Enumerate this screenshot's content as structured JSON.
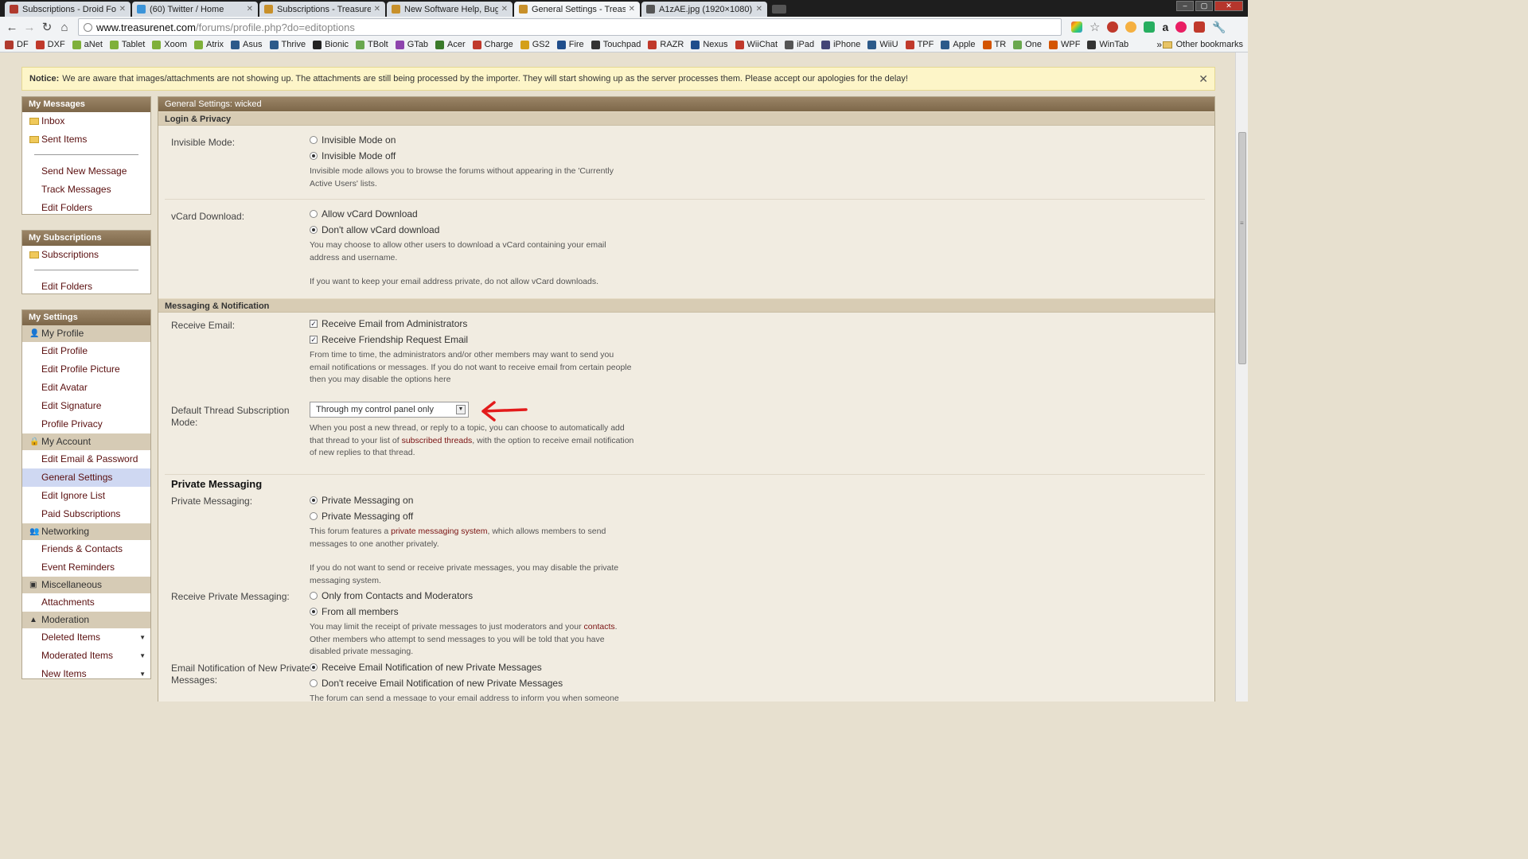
{
  "browser": {
    "tabs": [
      {
        "title": "Subscriptions - Droid Forum",
        "color": "#b03a2e",
        "active": false
      },
      {
        "title": "(60) Twitter / Home",
        "color": "#3b94d9",
        "active": false
      },
      {
        "title": "Subscriptions - TreasureNet",
        "color": "#c8902a",
        "active": false
      },
      {
        "title": "New Software Help, Bug, Gl",
        "color": "#c8902a",
        "active": false
      },
      {
        "title": "General Settings - TreasureN",
        "color": "#c8902a",
        "active": true
      },
      {
        "title": "A1zAE.jpg (1920×1080)",
        "color": "#555555",
        "active": false
      }
    ],
    "url_host": "www.treasurenet.com",
    "url_path": "/forums/profile.php?do=editoptions",
    "bookmarks": [
      {
        "label": "DF",
        "color": "#b03a2e"
      },
      {
        "label": "DXF",
        "color": "#c0392b"
      },
      {
        "label": "aNet",
        "color": "#7fb03a"
      },
      {
        "label": "Tablet",
        "color": "#7fb03a"
      },
      {
        "label": "Xoom",
        "color": "#7fb03a"
      },
      {
        "label": "Atrix",
        "color": "#7fb03a"
      },
      {
        "label": "Asus",
        "color": "#2c5a8a"
      },
      {
        "label": "Thrive",
        "color": "#2c5a8a"
      },
      {
        "label": "Bionic",
        "color": "#222222"
      },
      {
        "label": "TBolt",
        "color": "#6aa84f"
      },
      {
        "label": "GTab",
        "color": "#8e44ad"
      },
      {
        "label": "Acer",
        "color": "#3a7a2a"
      },
      {
        "label": "Charge",
        "color": "#c0392b"
      },
      {
        "label": "GS2",
        "color": "#d4a017"
      },
      {
        "label": "Fire",
        "color": "#1f4e8c"
      },
      {
        "label": "Touchpad",
        "color": "#333333"
      },
      {
        "label": "RAZR",
        "color": "#c0392b"
      },
      {
        "label": "Nexus",
        "color": "#1f4e8c"
      },
      {
        "label": "WiiChat",
        "color": "#c0392b"
      },
      {
        "label": "iPad",
        "color": "#555555"
      },
      {
        "label": "iPhone",
        "color": "#444477"
      },
      {
        "label": "WiiU",
        "color": "#2c5a8a"
      },
      {
        "label": "TPF",
        "color": "#c0392b"
      },
      {
        "label": "Apple",
        "color": "#2c5a8a"
      },
      {
        "label": "TR",
        "color": "#d35400"
      },
      {
        "label": "One",
        "color": "#6aa84f"
      },
      {
        "label": "WPF",
        "color": "#d35400"
      },
      {
        "label": "WinTab",
        "color": "#333333"
      }
    ],
    "bookmarks_more": "»",
    "other_bookmarks": "Other bookmarks"
  },
  "notice": {
    "label": "Notice:",
    "text": "We are aware that images/attachments are not showing up. The attachments are still being processed by the importer. They will start showing up as the server processes them. Please accept our apologies for the delay!"
  },
  "sidebar": {
    "messages": {
      "title": "My Messages",
      "folders": [
        "Inbox",
        "Sent Items"
      ],
      "links": [
        "Send New Message",
        "Track Messages",
        "Edit Folders"
      ]
    },
    "subscriptions": {
      "title": "My Subscriptions",
      "folders": [
        "Subscriptions"
      ],
      "links": [
        "Edit Folders"
      ]
    },
    "settings": {
      "title": "My Settings",
      "groups": [
        {
          "name": "My Profile",
          "icon": "user-icon",
          "items": [
            "Edit Profile",
            "Edit Profile Picture",
            "Edit Avatar",
            "Edit Signature",
            "Profile Privacy"
          ]
        },
        {
          "name": "My Account",
          "icon": "lock-icon",
          "items": [
            "Edit Email & Password",
            "General Settings",
            "Edit Ignore List",
            "Paid Subscriptions"
          ]
        },
        {
          "name": "Networking",
          "icon": "people-icon",
          "items": [
            "Friends & Contacts",
            "Event Reminders"
          ]
        },
        {
          "name": "Miscellaneous",
          "icon": "misc-icon",
          "items": [
            "Attachments"
          ]
        },
        {
          "name": "Moderation",
          "icon": "warning-icon",
          "items": [
            "Deleted Items",
            "Moderated Items",
            "New Items"
          ]
        }
      ],
      "active_item": "General Settings"
    }
  },
  "main": {
    "title": "General Settings: wicked",
    "login_privacy": {
      "heading": "Login & Privacy",
      "invisible": {
        "label": "Invisible Mode:",
        "options": [
          "Invisible Mode on",
          "Invisible Mode off"
        ],
        "selected": 1,
        "desc": "Invisible mode allows you to browse the forums without appearing in the 'Currently Active Users' lists."
      },
      "vcard": {
        "label": "vCard Download:",
        "options": [
          "Allow vCard Download",
          "Don't allow vCard download"
        ],
        "selected": 1,
        "desc1": "You may choose to allow other users to download a vCard containing your email address and username.",
        "desc2": "If you want to keep your email address private, do not allow vCard downloads."
      }
    },
    "messaging": {
      "heading": "Messaging & Notification",
      "receive_email": {
        "label": "Receive Email:",
        "options": [
          "Receive Email from Administrators",
          "Receive Friendship Request Email"
        ],
        "checked": [
          true,
          true
        ],
        "desc": "From time to time, the administrators and/or other members may want to send you email notifications or messages. If you do not want to receive email from certain people then you may disable the options here"
      },
      "subscription_mode": {
        "label": "Default Thread Subscription Mode:",
        "selected": "Through my control panel only",
        "desc_before": "When you post a new thread, or reply to a topic, you can choose to automatically add that thread to your list of ",
        "desc_link": "subscribed threads",
        "desc_after": ", with the option to receive email notification of new replies to that thread."
      }
    },
    "private_messaging": {
      "heading": "Private Messaging",
      "pm": {
        "label": "Private Messaging:",
        "options": [
          "Private Messaging on",
          "Private Messaging off"
        ],
        "selected": 0,
        "desc_before": "This forum features a ",
        "desc_link": "private messaging system",
        "desc_after": ", which allows members to send messages to one another privately.",
        "desc2": "If you do not want to send or receive private messages, you may disable the private messaging system."
      },
      "receive_pm": {
        "label": "Receive Private Messaging:",
        "options": [
          "Only from Contacts and Moderators",
          "From all members"
        ],
        "selected": 1,
        "desc_before": "You may limit the receipt of private messages to just moderators and your ",
        "desc_link": "contacts",
        "desc_after": ". Other members who attempt to send messages to you will be told that you have disabled private messaging."
      },
      "email_notify": {
        "label": "Email Notification of New Private Messages:",
        "options": [
          "Receive Email Notification of new Private Messages",
          "Don't receive Email Notification of new Private Messages"
        ],
        "selected": 0,
        "desc": "The forum can send a message to your email address to inform you when someone"
      }
    }
  },
  "colors": {
    "accent_link": "#7a1212",
    "header_brown": "#8c7558",
    "page_bg": "#e7e0cf",
    "annotation_red": "#e31b1b"
  }
}
